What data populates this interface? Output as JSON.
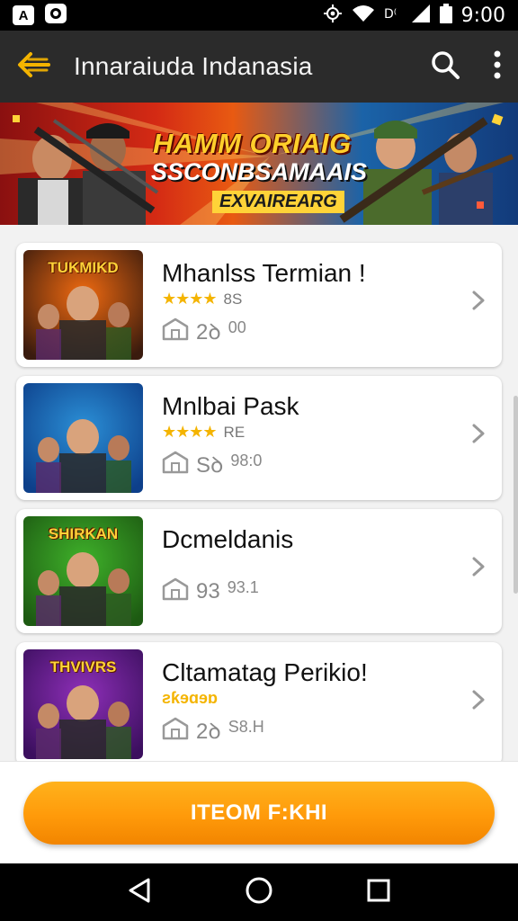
{
  "status_bar": {
    "badge_a": "A",
    "time": "9:00"
  },
  "app_bar": {
    "title": "Innaraiuda Indanasia",
    "icons": [
      "back-arrow-icon",
      "search-icon",
      "more-vert-icon"
    ]
  },
  "banner": {
    "line1": "HAMM ORIAIG",
    "line2": "SSCONBSAMAAIS",
    "line3": "EXVAIREARG"
  },
  "games": [
    {
      "title": "Mhanlss Termian !",
      "has_stars": true,
      "stars": "★★★★",
      "rating": "8S",
      "meta_main": "2ꝺ",
      "meta_sub": "00",
      "thumb_text": "TUKMIKD",
      "thumb_colors": [
        "#f06a10",
        "#3a1b0e"
      ]
    },
    {
      "title": "Mnlbai Pask",
      "has_stars": true,
      "stars": "★★★★",
      "rating": "RE",
      "meta_main": "Sꝺ",
      "meta_sub": "98:0",
      "thumb_text": "",
      "thumb_colors": [
        "#2b8fd6",
        "#0d3f8a"
      ]
    },
    {
      "title": "Dcmeldanis",
      "has_stars": false,
      "stars": "",
      "rating": "",
      "meta_main": "93",
      "meta_sub": "93.1",
      "thumb_text": "SHIRKAN",
      "thumb_colors": [
        "#3fb12a",
        "#1d5a12"
      ]
    },
    {
      "title": "Cltamatag Perikio!",
      "has_stars": false,
      "stars_label": "ƨƙɘɑɘɒ",
      "rating": "",
      "meta_main": "2ꝺ",
      "meta_sub": "S8.H",
      "thumb_text": "THVIVRS",
      "thumb_colors": [
        "#8e2fb8",
        "#3b0f5e"
      ]
    }
  ],
  "cta": {
    "label": "ITEOM F:KHI"
  },
  "nav": {
    "icons": [
      "back-triangle-icon",
      "home-circle-icon",
      "recents-square-icon"
    ]
  },
  "colors": {
    "accent": "#ff9a0a",
    "star": "#f4b400",
    "appbar": "#2b2b2b"
  }
}
